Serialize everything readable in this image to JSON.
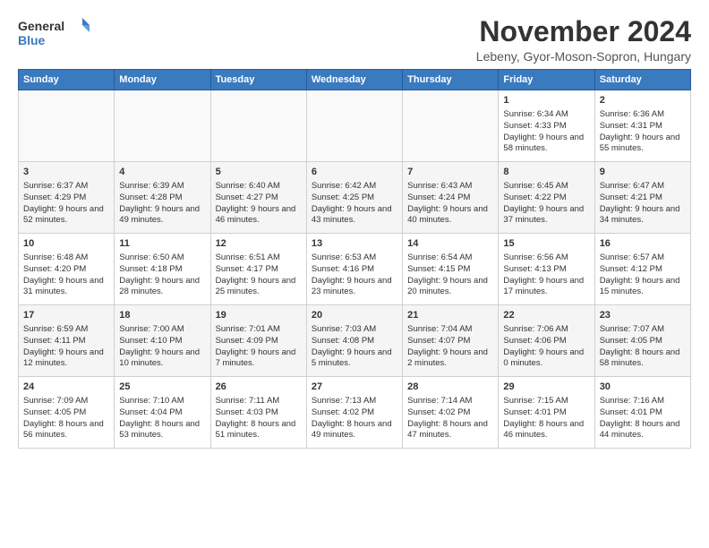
{
  "logo": {
    "text_general": "General",
    "text_blue": "Blue"
  },
  "title": "November 2024",
  "subtitle": "Lebeny, Gyor-Moson-Sopron, Hungary",
  "weekdays": [
    "Sunday",
    "Monday",
    "Tuesday",
    "Wednesday",
    "Thursday",
    "Friday",
    "Saturday"
  ],
  "weeks": [
    [
      {
        "day": "",
        "info": ""
      },
      {
        "day": "",
        "info": ""
      },
      {
        "day": "",
        "info": ""
      },
      {
        "day": "",
        "info": ""
      },
      {
        "day": "",
        "info": ""
      },
      {
        "day": "1",
        "info": "Sunrise: 6:34 AM\nSunset: 4:33 PM\nDaylight: 9 hours and 58 minutes."
      },
      {
        "day": "2",
        "info": "Sunrise: 6:36 AM\nSunset: 4:31 PM\nDaylight: 9 hours and 55 minutes."
      }
    ],
    [
      {
        "day": "3",
        "info": "Sunrise: 6:37 AM\nSunset: 4:29 PM\nDaylight: 9 hours and 52 minutes."
      },
      {
        "day": "4",
        "info": "Sunrise: 6:39 AM\nSunset: 4:28 PM\nDaylight: 9 hours and 49 minutes."
      },
      {
        "day": "5",
        "info": "Sunrise: 6:40 AM\nSunset: 4:27 PM\nDaylight: 9 hours and 46 minutes."
      },
      {
        "day": "6",
        "info": "Sunrise: 6:42 AM\nSunset: 4:25 PM\nDaylight: 9 hours and 43 minutes."
      },
      {
        "day": "7",
        "info": "Sunrise: 6:43 AM\nSunset: 4:24 PM\nDaylight: 9 hours and 40 minutes."
      },
      {
        "day": "8",
        "info": "Sunrise: 6:45 AM\nSunset: 4:22 PM\nDaylight: 9 hours and 37 minutes."
      },
      {
        "day": "9",
        "info": "Sunrise: 6:47 AM\nSunset: 4:21 PM\nDaylight: 9 hours and 34 minutes."
      }
    ],
    [
      {
        "day": "10",
        "info": "Sunrise: 6:48 AM\nSunset: 4:20 PM\nDaylight: 9 hours and 31 minutes."
      },
      {
        "day": "11",
        "info": "Sunrise: 6:50 AM\nSunset: 4:18 PM\nDaylight: 9 hours and 28 minutes."
      },
      {
        "day": "12",
        "info": "Sunrise: 6:51 AM\nSunset: 4:17 PM\nDaylight: 9 hours and 25 minutes."
      },
      {
        "day": "13",
        "info": "Sunrise: 6:53 AM\nSunset: 4:16 PM\nDaylight: 9 hours and 23 minutes."
      },
      {
        "day": "14",
        "info": "Sunrise: 6:54 AM\nSunset: 4:15 PM\nDaylight: 9 hours and 20 minutes."
      },
      {
        "day": "15",
        "info": "Sunrise: 6:56 AM\nSunset: 4:13 PM\nDaylight: 9 hours and 17 minutes."
      },
      {
        "day": "16",
        "info": "Sunrise: 6:57 AM\nSunset: 4:12 PM\nDaylight: 9 hours and 15 minutes."
      }
    ],
    [
      {
        "day": "17",
        "info": "Sunrise: 6:59 AM\nSunset: 4:11 PM\nDaylight: 9 hours and 12 minutes."
      },
      {
        "day": "18",
        "info": "Sunrise: 7:00 AM\nSunset: 4:10 PM\nDaylight: 9 hours and 10 minutes."
      },
      {
        "day": "19",
        "info": "Sunrise: 7:01 AM\nSunset: 4:09 PM\nDaylight: 9 hours and 7 minutes."
      },
      {
        "day": "20",
        "info": "Sunrise: 7:03 AM\nSunset: 4:08 PM\nDaylight: 9 hours and 5 minutes."
      },
      {
        "day": "21",
        "info": "Sunrise: 7:04 AM\nSunset: 4:07 PM\nDaylight: 9 hours and 2 minutes."
      },
      {
        "day": "22",
        "info": "Sunrise: 7:06 AM\nSunset: 4:06 PM\nDaylight: 9 hours and 0 minutes."
      },
      {
        "day": "23",
        "info": "Sunrise: 7:07 AM\nSunset: 4:05 PM\nDaylight: 8 hours and 58 minutes."
      }
    ],
    [
      {
        "day": "24",
        "info": "Sunrise: 7:09 AM\nSunset: 4:05 PM\nDaylight: 8 hours and 56 minutes."
      },
      {
        "day": "25",
        "info": "Sunrise: 7:10 AM\nSunset: 4:04 PM\nDaylight: 8 hours and 53 minutes."
      },
      {
        "day": "26",
        "info": "Sunrise: 7:11 AM\nSunset: 4:03 PM\nDaylight: 8 hours and 51 minutes."
      },
      {
        "day": "27",
        "info": "Sunrise: 7:13 AM\nSunset: 4:02 PM\nDaylight: 8 hours and 49 minutes."
      },
      {
        "day": "28",
        "info": "Sunrise: 7:14 AM\nSunset: 4:02 PM\nDaylight: 8 hours and 47 minutes."
      },
      {
        "day": "29",
        "info": "Sunrise: 7:15 AM\nSunset: 4:01 PM\nDaylight: 8 hours and 46 minutes."
      },
      {
        "day": "30",
        "info": "Sunrise: 7:16 AM\nSunset: 4:01 PM\nDaylight: 8 hours and 44 minutes."
      }
    ]
  ]
}
